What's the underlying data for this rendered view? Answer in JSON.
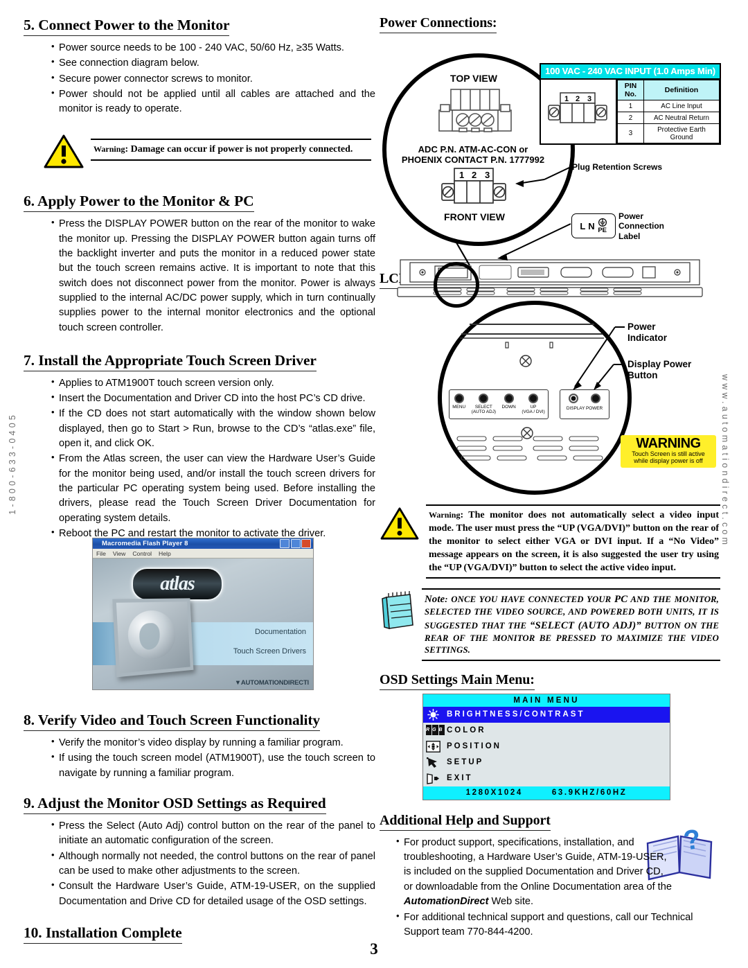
{
  "page_number": "3",
  "side_text": {
    "left": "1-800-633-0405",
    "right": "www.automationdirect.com"
  },
  "left_column": {
    "section5": {
      "heading": "5. Connect Power to the Monitor",
      "bullets": [
        "Power source needs to be 100 - 240 VAC, 50/60 Hz, ≥35 Watts.",
        "See connection diagram below.",
        "Secure power connector screws to monitor.",
        "Power should not be applied until all cables are attached and the monitor is ready to operate."
      ],
      "warning_label": "Warning",
      "warning_text": ": Damage can occur if power is not properly connected."
    },
    "section6": {
      "heading": "6. Apply Power to the Monitor & PC",
      "bullets": [
        "Press the DISPLAY POWER button on the rear of the monitor to wake the monitor up. Pressing the DISPLAY POWER button again turns off the backlight inverter and puts the monitor in a reduced power state but the touch screen remains active. It is important to note that this switch does not disconnect power from the monitor. Power is always supplied to the internal AC/DC power supply, which in turn continually supplies power to the internal monitor electronics and the optional touch screen controller."
      ]
    },
    "section7": {
      "heading": "7. Install the Appropriate Touch Screen Driver",
      "bullets": [
        "Applies to ATM1900T touch screen version only.",
        "Insert the Documentation and Driver CD into the host PC’s CD drive.",
        "If the CD does not start automatically with the window shown below displayed, then go to Start > Run, browse to the CD’s “atlas.exe” file, open it, and click OK.",
        "From the Atlas screen, the user can view the Hardware User’s Guide for the monitor being used, and/or install the touch screen drivers for the particular PC operating system being used. Before installing the drivers, please read the Touch Screen Driver Documentation for operating system details.",
        "Reboot the PC and restart the monitor to activate the driver."
      ]
    },
    "atlas_window": {
      "title": "Macromedia Flash Player 8",
      "menu": [
        "File",
        "View",
        "Control",
        "Help"
      ],
      "logo": "atlas",
      "links": [
        "Documentation",
        "Touch Screen Drivers"
      ],
      "footer": "▼AUTOMATIONDIRECTl"
    },
    "section8": {
      "heading": "8. Verify Video and Touch Screen Functionality",
      "bullets": [
        "Verify the monitor’s video display by running a familiar program.",
        "If using the touch screen model (ATM1900T), use the touch screen to navigate by running a familiar program."
      ]
    },
    "section9": {
      "heading": "9. Adjust the Monitor OSD Settings as Required",
      "bullets": [
        "Press the Select (Auto Adj) control button on the rear of the panel to initiate an automatic configuration of the screen.",
        "Although normally not needed, the control buttons on the rear of panel can be used to make other adjustments to the screen.",
        "Consult the Hardware User’s Guide, ATM-19-USER, on the supplied Documentation and Drive CD for detailed usage of the OSD settings."
      ]
    },
    "section10": {
      "heading": "10. Installation Complete"
    }
  },
  "right_column": {
    "power_connections": {
      "heading": "Power Connections:",
      "top_view_label": "TOP VIEW",
      "front_view_label": "FRONT VIEW",
      "part_number_line1": "ADC P.N. ATM-AC-CON or",
      "part_number_line2": "PHOENIX CONTACT P.N. 1777992",
      "pin_numbers": [
        "1",
        "2",
        "3"
      ],
      "plug_retention_label": "Plug Retention Screws",
      "power_connection_label": "Power\nConnection\nLabel",
      "power_label_text": {
        "l": "L",
        "n": "N",
        "pe": "PE"
      },
      "table": {
        "header": "100 VAC - 240 VAC INPUT (1.0 Amps Min)",
        "columns": [
          "PIN No.",
          "Definition"
        ],
        "rows": [
          [
            "1",
            "AC Line Input"
          ],
          [
            "2",
            "AC Neutral Return"
          ],
          [
            "3",
            "Protective Earth Ground"
          ]
        ],
        "header_color": "#00e2e8",
        "subheader_color": "#bff3f7"
      }
    },
    "lcd_power_button": {
      "heading": "LCD Power Button:",
      "buttons": [
        {
          "label": "MENU",
          "sub": ""
        },
        {
          "label": "SELECT",
          "sub": "(AUTO ADJ)"
        },
        {
          "label": "DOWN",
          "sub": ""
        },
        {
          "label": "UP",
          "sub": "(VGA / DVI)"
        }
      ],
      "display_power_label": "DISPLAY POWER",
      "callout_power_indicator": "Power\nIndicator",
      "callout_display_power": "Display Power\nButton",
      "warning_badge": {
        "title": "WARNING",
        "text": "Touch Screen is still active while display power is off",
        "color": "#ffef2a"
      }
    },
    "warning_video": {
      "label": "Warning",
      "text": ": The monitor does not automatically select a video input mode. The user must press the “UP (VGA/DVI)” button on the rear of the monitor to select either VGA or DVI input. If a “No Video” message appears on the screen, it is also suggested the user try using the “UP (VGA/DVI)” button to select the active video input."
    },
    "note_block": {
      "label": "Note",
      "text_before": ": ONCE YOU HAVE CONNECTED YOUR ",
      "pc": "PC",
      "text_mid": " AND THE MONITOR, SELECTED THE VIDEO SOURCE, AND POWERED BOTH UNITS, IT IS SUGGESTED THAT THE ",
      "quote": "“SELECT (AUTO ADJ)”",
      "text_after": " BUTTON ON THE REAR OF THE MONITOR BE PRESSED TO MAXIMIZE THE VIDEO SETTINGS."
    },
    "osd": {
      "heading": "OSD Settings Main Menu:",
      "title": "MAIN MENU",
      "items": [
        {
          "label": "BRIGHTNESS/CONTRAST",
          "icon": "brightness-icon",
          "selected": true
        },
        {
          "label": "COLOR",
          "icon": "rgb-color-icon",
          "selected": false
        },
        {
          "label": "POSITION",
          "icon": "position-arrows-icon",
          "selected": false
        },
        {
          "label": "SETUP",
          "icon": "setup-pointer-icon",
          "selected": false
        },
        {
          "label": "EXIT",
          "icon": "exit-door-icon",
          "selected": false
        }
      ],
      "status_resolution": "1280X1024",
      "status_frequency": "63.9KHZ/60HZ",
      "bar_color": "#0ff0ff",
      "highlight_color": "#1a14f0"
    },
    "help": {
      "heading": "Additional Help and Support",
      "bullet1_a": "For product support, specifications, installation, and troubleshooting, a Hardware User’s Guide, ATM-19-USER, is included on the supplied Documentation and Driver CD, or downloadable from the Online Documentation area of the ",
      "bullet1_brand": "AutomationDirect",
      "bullet1_b": " Web site.",
      "bullet2": "For additional technical support and questions, call our Technical Support team 770-844-4200."
    }
  }
}
